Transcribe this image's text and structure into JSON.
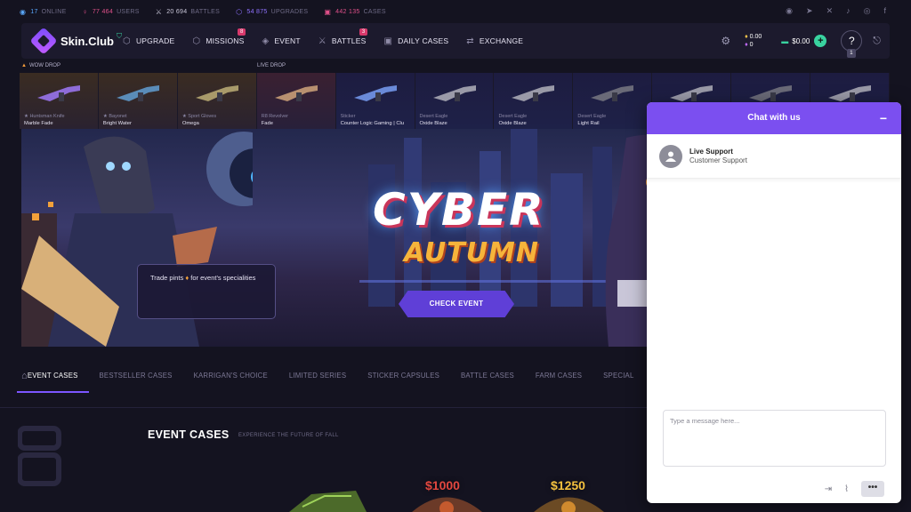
{
  "stats": [
    {
      "icon": "online-icon",
      "value": "17",
      "label": "ONLINE",
      "color": "#5aa9ff"
    },
    {
      "icon": "users-icon",
      "value": "77 464",
      "label": "USERS",
      "color": "#e0508a"
    },
    {
      "icon": "battles-icon",
      "value": "20 694",
      "label": "BATTLES",
      "color": "#c9c6d8"
    },
    {
      "icon": "upgrades-icon",
      "value": "54 875",
      "label": "UPGRADES",
      "color": "#8f72ff"
    },
    {
      "icon": "cases-icon",
      "value": "442 135",
      "label": "CASES",
      "color": "#e0508a"
    }
  ],
  "socials": [
    "discord-icon",
    "telegram-icon",
    "x-icon",
    "tiktok-icon",
    "instagram-icon",
    "facebook-icon"
  ],
  "nav": {
    "logo_text": "Skin.Club",
    "items": [
      {
        "label": "UPGRADE",
        "badge": ""
      },
      {
        "label": "MISSIONS",
        "badge": "8"
      },
      {
        "label": "EVENT",
        "badge": ""
      },
      {
        "label": "BATTLES",
        "badge": "3"
      },
      {
        "label": "DAILY CASES",
        "badge": ""
      },
      {
        "label": "EXCHANGE",
        "badge": ""
      }
    ],
    "coins_gold": "0.00",
    "coins_purple": "0",
    "balance": "$0.00",
    "help_badge": "1"
  },
  "drops": {
    "wow_label": "WOW DROP",
    "live_label": "LIVE DROP",
    "items": [
      {
        "cat": "★ Huntsman Knife",
        "name": "Marble Fade",
        "kind": "wow"
      },
      {
        "cat": "★ Bayonet",
        "name": "Bright Water",
        "kind": "wow"
      },
      {
        "cat": "★ Sport Gloves",
        "name": "Omega",
        "kind": "wow"
      },
      {
        "cat": "R8 Revolver",
        "name": "Fade",
        "kind": "red"
      },
      {
        "cat": "Sticker",
        "name": "Counter Logic Gaming | Clu",
        "kind": "live"
      },
      {
        "cat": "Desert Eagle",
        "name": "Oxide Blaze",
        "kind": "live"
      },
      {
        "cat": "Desert Eagle",
        "name": "Oxide Blaze",
        "kind": "live"
      },
      {
        "cat": "Desert Eagle",
        "name": "Light Rail",
        "kind": "live"
      },
      {
        "cat": "",
        "name": "",
        "kind": "live"
      },
      {
        "cat": "",
        "name": "",
        "kind": "live"
      },
      {
        "cat": "",
        "name": "",
        "kind": "live"
      }
    ]
  },
  "banner": {
    "title1": "CYBER",
    "title2": "AUTUMN",
    "cta": "CHECK EVENT",
    "trade_text_before": "Trade pints",
    "trade_text_after": "for event's specialities"
  },
  "tabs": [
    "EVENT CASES",
    "BESTSELLER CASES",
    "KARRIGAN'S CHOICE",
    "LIMITED SERIES",
    "STICKER CAPSULES",
    "BATTLE CASES",
    "FARM CASES",
    "SPECIAL"
  ],
  "section": {
    "title": "EVENT CASES",
    "subtitle": "EXPERIENCE THE FUTURE OF FALL",
    "prices": [
      "$1000",
      "$1250"
    ]
  },
  "chat": {
    "title": "Chat with us",
    "agent_name": "Live Support",
    "agent_role": "Customer Support",
    "placeholder": "Type a message here..."
  }
}
